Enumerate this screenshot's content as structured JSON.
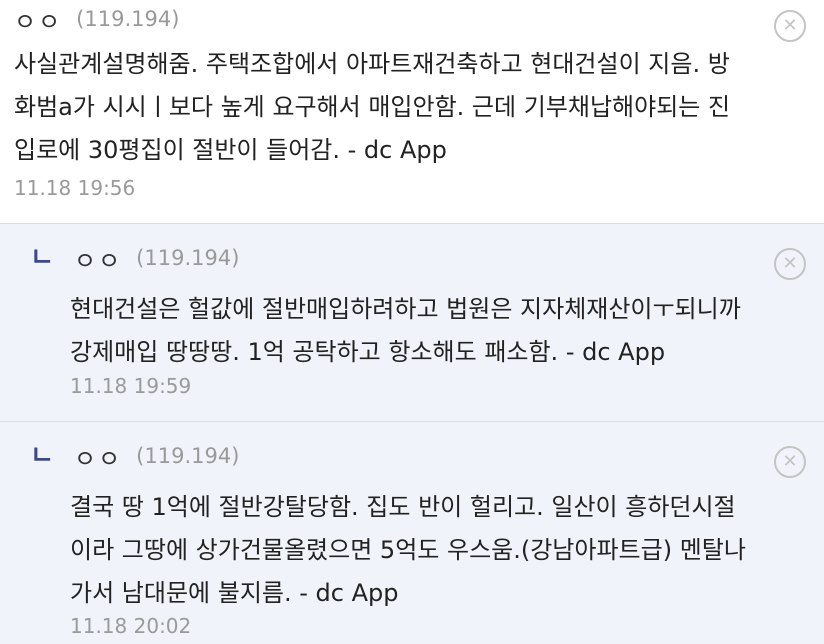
{
  "comments": [
    {
      "author": "ㅇㅇ",
      "ip": "(119.194)",
      "lines": [
        "사실관계설명해줌. 주택조합에서 아파트재건축하고 현대건설이 지음. 방",
        "화범a가 시시ㅣ보다 높게 요구해서 매입안함. 근데 기부채납해야되는 진",
        "입로에 30평집이 절반이 들어감. - dc App"
      ],
      "date": "11.18 19:56"
    }
  ],
  "replies": [
    {
      "reply_mark": "ㄴ",
      "author": "ㅇㅇ",
      "ip": "(119.194)",
      "lines": [
        "현대건설은 헐값에 절반매입하려하고 법원은 지자체재산이ㅜ되니까",
        "강제매입 땅땅땅. 1억 공탁하고 항소해도 패소함. - dc App"
      ],
      "date": "11.18 19:59"
    },
    {
      "reply_mark": "ㄴ",
      "author": "ㅇㅇ",
      "ip": "(119.194)",
      "lines": [
        "결국 땅 1억에 절반강탈당함. 집도 반이 헐리고. 일산이 흥하던시절",
        "이라 그땅에 상가건물올렸으면 5억도 우스움.(강남아파트급) 멘탈나",
        "가서 남대문에 불지름. - dc App"
      ],
      "date": "11.18 20:02"
    }
  ],
  "icons": {
    "close": "close-circle-icon"
  },
  "colors": {
    "reply_background": "#f1f3fb",
    "reply_mark": "#3b4890",
    "meta_gray": "#999999"
  }
}
